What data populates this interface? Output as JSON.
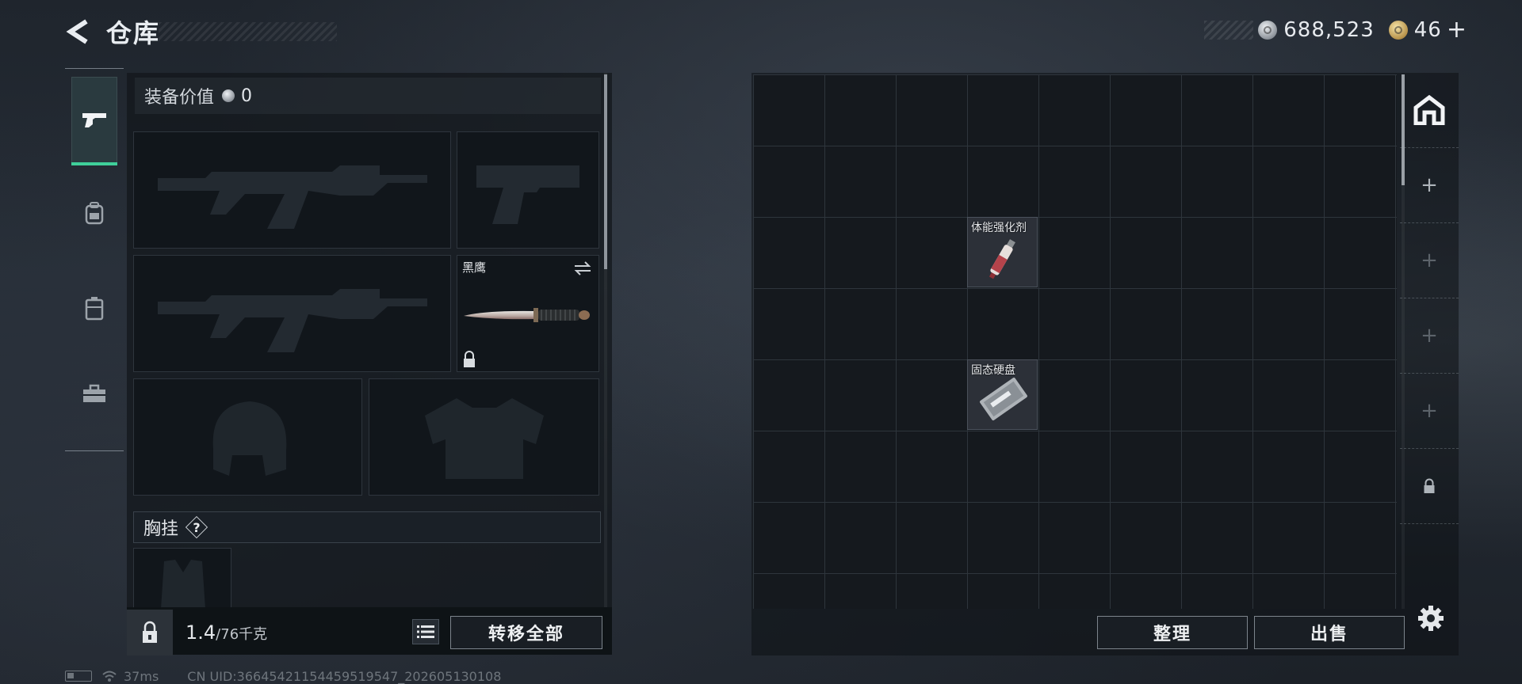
{
  "header": {
    "title": "仓库"
  },
  "currency": {
    "silver": "688,523",
    "gold": "46",
    "gold_plus": "+"
  },
  "tabs": [
    {
      "name": "weapons",
      "icon": "pistol-icon",
      "active": true
    },
    {
      "name": "backpack",
      "icon": "backpack-icon",
      "active": false
    },
    {
      "name": "container",
      "icon": "container-icon",
      "active": false
    },
    {
      "name": "medkit",
      "icon": "toolbox-icon",
      "active": false
    }
  ],
  "loadout": {
    "value_label": "装备价值",
    "value": "0",
    "melee": {
      "label": "黑鹰",
      "locked": true
    },
    "chest_label": "胸挂",
    "chest_help": "?",
    "weight": "1.4",
    "weight_max": "/76千克",
    "transfer_all": "转移全部"
  },
  "stash": {
    "items": [
      {
        "label": "体能强化剂",
        "icon": "syringe-icon"
      },
      {
        "label": "固态硬盘",
        "icon": "ssd-icon"
      }
    ],
    "pages": [
      {
        "type": "home",
        "icon": "home-icon"
      },
      {
        "type": "add",
        "label": "+"
      },
      {
        "type": "add",
        "label": "+"
      },
      {
        "type": "add",
        "label": "+"
      },
      {
        "type": "add",
        "label": "+"
      },
      {
        "type": "locked",
        "icon": "lock-icon"
      }
    ],
    "sort_label": "整理",
    "sell_label": "出售"
  },
  "status_bar": {
    "ping": "37ms",
    "uid": "CN UID:36645421154459519547_202605130108"
  },
  "colors": {
    "accent_green": "#3fcf9a",
    "panel_bg": "#11161b",
    "grid_line": "#2e353c"
  }
}
